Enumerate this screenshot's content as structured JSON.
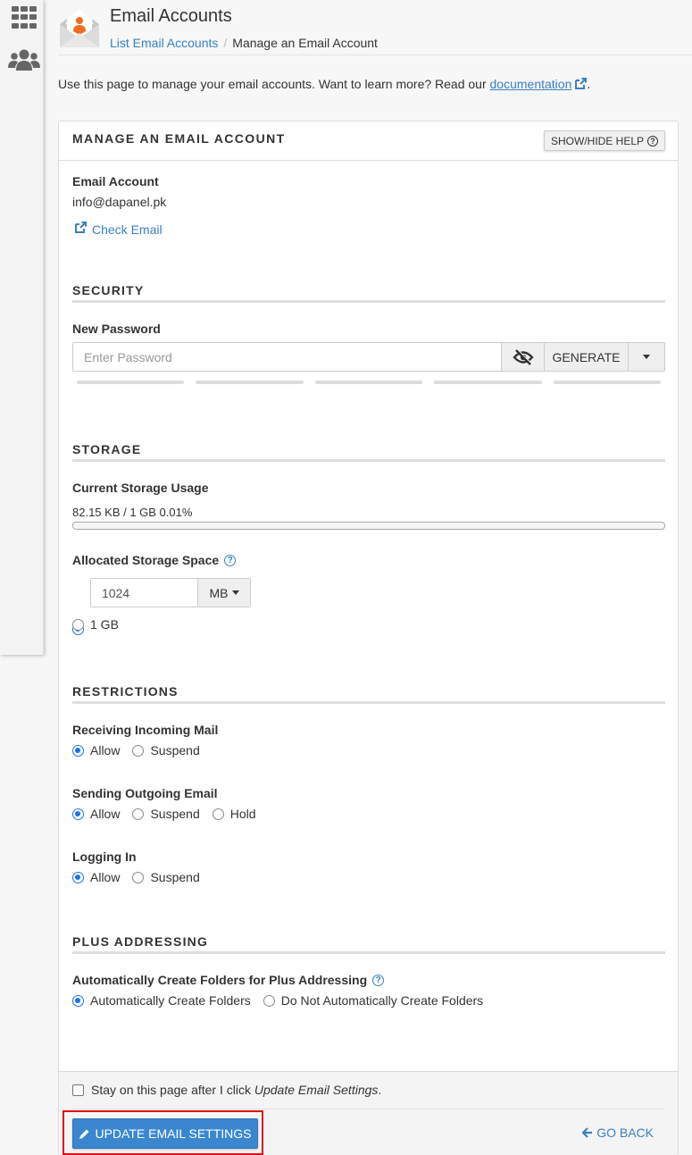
{
  "sidebar": {
    "icons": [
      {
        "name": "apps-grid-icon"
      },
      {
        "name": "users-icon"
      }
    ]
  },
  "header": {
    "title": "Email Accounts",
    "breadcrumb": {
      "parent": "List Email Accounts",
      "separator": "/",
      "current": "Manage an Email Account"
    }
  },
  "intro": {
    "text": "Use this page to manage your email accounts. Want to learn more? Read our",
    "link": "documentation",
    "suffix": "."
  },
  "panel": {
    "title": "MANAGE AN EMAIL ACCOUNT",
    "help_button": "SHOW/HIDE HELP",
    "account": {
      "label": "Email Account",
      "value": "info@dapanel.pk",
      "check_email": "Check Email"
    },
    "security": {
      "title": "SECURITY",
      "password_label": "New Password",
      "password_placeholder": "Enter Password",
      "password_value": "",
      "generate_label": "GENERATE",
      "strength_segments": 5
    },
    "storage": {
      "title": "STORAGE",
      "usage_label": "Current Storage Usage",
      "usage_text": "82.15 KB / 1 GB 0.01%",
      "usage_percent": 0.01,
      "allocated_label": "Allocated Storage Space",
      "quota_value": "1024",
      "quota_unit": "MB",
      "option_fixed_selected": true,
      "option_alt_label": "1 GB"
    },
    "restrictions": {
      "title": "RESTRICTIONS",
      "groups": [
        {
          "label": "Receiving Incoming Mail",
          "options": [
            "Allow",
            "Suspend"
          ],
          "selected": "Allow"
        },
        {
          "label": "Sending Outgoing Email",
          "options": [
            "Allow",
            "Suspend",
            "Hold"
          ],
          "selected": "Allow"
        },
        {
          "label": "Logging In",
          "options": [
            "Allow",
            "Suspend"
          ],
          "selected": "Allow"
        }
      ]
    },
    "plus_addressing": {
      "title": "PLUS ADDRESSING",
      "label": "Automatically Create Folders for Plus Addressing",
      "options": [
        "Automatically Create Folders",
        "Do Not Automatically Create Folders"
      ],
      "selected": "Automatically Create Folders"
    }
  },
  "footer": {
    "stay_text": "Stay on this page after I click",
    "stay_emphasis": "Update Email Settings",
    "stay_suffix": ".",
    "stay_checked": false,
    "update_button": "UPDATE EMAIL SETTINGS",
    "go_back": "GO BACK"
  },
  "colors": {
    "accent": "#3a80c0",
    "primary_button": "#3a87d0",
    "highlight_border": "#e01010",
    "brand_orange": "#f26c22"
  }
}
